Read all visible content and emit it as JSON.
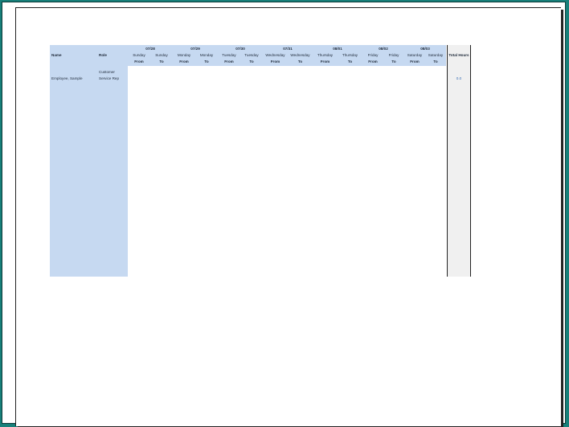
{
  "headers": {
    "name": "Name",
    "role": "Role",
    "total_hours": "Total Hours"
  },
  "dates": [
    "07/28",
    "07/29",
    "07/30",
    "07/31",
    "08/01",
    "08/02",
    "08/03"
  ],
  "days": [
    {
      "day": "Sunday",
      "from": "From",
      "to": "To"
    },
    {
      "day": "Monday",
      "from": "From",
      "to": "To"
    },
    {
      "day": "Tuesday",
      "from": "From",
      "to": "To"
    },
    {
      "day": "Wednesday",
      "from": "From",
      "to": "To"
    },
    {
      "day": "Thursday",
      "from": "From",
      "to": "To"
    },
    {
      "day": "Friday",
      "from": "From",
      "to": "To"
    },
    {
      "day": "Saturday",
      "from": "From",
      "to": "To"
    }
  ],
  "rows": [
    {
      "name": "Employee, Sample",
      "role_line1": "Customer",
      "role_line2": "Service Rep",
      "total": "0.0"
    }
  ]
}
